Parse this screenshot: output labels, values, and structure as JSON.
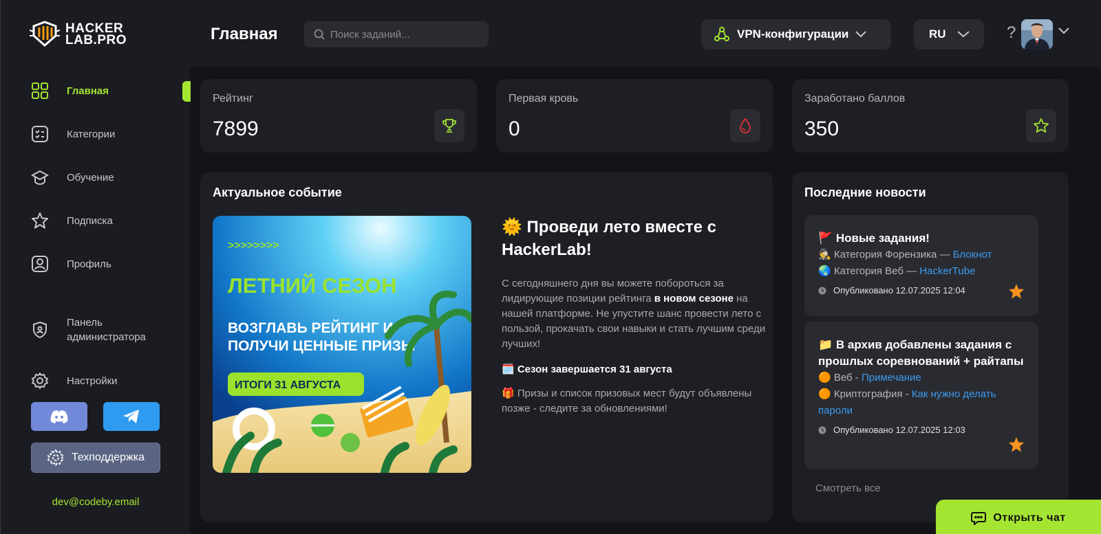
{
  "brand": {
    "line1": "HACKER",
    "line2": "LAB.PRO"
  },
  "sidebar": {
    "items": [
      {
        "label": "Главная",
        "icon": "grid-icon",
        "active": true
      },
      {
        "label": "Категории",
        "icon": "list-icon"
      },
      {
        "label": "Обучение",
        "icon": "graduation-cap-icon"
      },
      {
        "label": "Подписка",
        "icon": "star-icon"
      },
      {
        "label": "Профиль",
        "icon": "user-icon"
      },
      {
        "label": "Панель администратора",
        "icon": "shield-icon"
      },
      {
        "label": "Настройки",
        "icon": "gear-icon"
      }
    ],
    "support_label": "Техподдержка",
    "email": "dev@codeby.email"
  },
  "header": {
    "title": "Главная",
    "search_placeholder": "Поиск заданий...",
    "vpn_label": "VPN-конфигурации",
    "lang_label": "RU",
    "help_label": "?"
  },
  "stats": [
    {
      "label": "Рейтинг",
      "value": "7899",
      "icon": "trophy-icon"
    },
    {
      "label": "Первая кровь",
      "value": "0",
      "icon": "drop-icon"
    },
    {
      "label": "Заработано баллов",
      "value": "350",
      "icon": "star-icon"
    }
  ],
  "event": {
    "section_title": "Актуальное событие",
    "banner": {
      "arrows": ">>>>>>>>",
      "headline": "ЛЕТНИЙ СЕЗОН",
      "line1": "ВОЗГЛАВЬ РЕЙТИНГ И",
      "line2": "ПОЛУЧИ ЦЕННЫЕ ПРИЗЫ",
      "badge": "ИТОГИ 31 АВГУСТА"
    },
    "title": "🌞 Проведи лето вместе с HackerLab!",
    "desc_part1": "С сегодняшнего дня вы можете побороться за лидирующие позиции рейтинга ",
    "desc_bold": "в новом сезоне",
    "desc_part2": " на нашей платформе. Не упустите шанс провести лето с пользой, прокачать свои навыки и стать лучшим среди лучших!",
    "season": "🗓️ Сезон завершается 31 августа",
    "prizes": "🎁 Призы и список призовых мест будут объявлены позже - следите за обновлениями!"
  },
  "news": {
    "section_title": "Последние новости",
    "items": [
      {
        "title": "🚩 Новые задания!",
        "lines": [
          {
            "prefix": "🕵️ Категория Форензика — ",
            "link": "Блокнот"
          },
          {
            "prefix": "🌏 Категория Веб — ",
            "link": "HackerTube"
          }
        ],
        "date": "Опубликовано 12.07.2025 12:04"
      },
      {
        "title": "📁 В архив добавлены задания с прошлых соревнований + райтапы",
        "lines": [
          {
            "prefix": "🟠 Веб - ",
            "link": "Примечание"
          },
          {
            "prefix": "🟠 Криптография - ",
            "link": "Как нужно делать пароли"
          }
        ],
        "date": "Опубликовано 12.07.2025 12:03"
      }
    ],
    "see_all": "Смотреть все"
  },
  "chat_button": "Открыть чат",
  "colors": {
    "accent": "#a4e532",
    "link": "#3b9cf0",
    "star": "#f7931e",
    "discord": "#7289da",
    "telegram": "#2f9bf0"
  }
}
